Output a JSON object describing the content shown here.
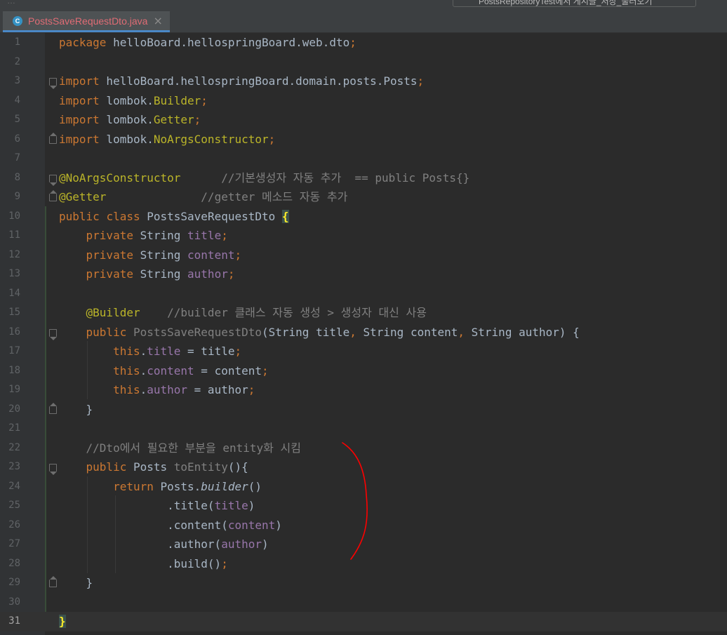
{
  "window": {
    "top_fragment_left": "…",
    "run_config": "PostsRepositoryTest에서 게시글_저장_불러오기"
  },
  "tab": {
    "icon_letter": "C",
    "filename": "PostsSaveRequestDto.java",
    "close_glyph": "×"
  },
  "lines": [
    {
      "n": "1",
      "text": "package helloBoard.hellospringBoard.web.dto;"
    },
    {
      "n": "2",
      "text": ""
    },
    {
      "n": "3",
      "text": "import helloBoard.hellospringBoard.domain.posts.Posts;"
    },
    {
      "n": "4",
      "text": "import lombok.Builder;"
    },
    {
      "n": "5",
      "text": "import lombok.Getter;"
    },
    {
      "n": "6",
      "text": "import lombok.NoArgsConstructor;"
    },
    {
      "n": "7",
      "text": ""
    },
    {
      "n": "8",
      "text": "@NoArgsConstructor      //기본생성자 자동 추가  == public Posts{}"
    },
    {
      "n": "9",
      "text": "@Getter              //getter 메소드 자동 추가"
    },
    {
      "n": "10",
      "text": "public class PostsSaveRequestDto {"
    },
    {
      "n": "11",
      "text": "    private String title;"
    },
    {
      "n": "12",
      "text": "    private String content;"
    },
    {
      "n": "13",
      "text": "    private String author;"
    },
    {
      "n": "14",
      "text": ""
    },
    {
      "n": "15",
      "text": "    @Builder    //builder 클래스 자동 생성 > 생성자 대신 사용"
    },
    {
      "n": "16",
      "text": "    public PostsSaveRequestDto(String title, String content, String author) {"
    },
    {
      "n": "17",
      "text": "        this.title = title;"
    },
    {
      "n": "18",
      "text": "        this.content = content;"
    },
    {
      "n": "19",
      "text": "        this.author = author;"
    },
    {
      "n": "20",
      "text": "    }"
    },
    {
      "n": "21",
      "text": ""
    },
    {
      "n": "22",
      "text": "    //Dto에서 필요한 부분을 entity화 시킴"
    },
    {
      "n": "23",
      "text": "    public Posts toEntity(){"
    },
    {
      "n": "24",
      "text": "        return Posts.builder()"
    },
    {
      "n": "25",
      "text": "                .title(title)"
    },
    {
      "n": "26",
      "text": "                .content(content)"
    },
    {
      "n": "27",
      "text": "                .author(author)"
    },
    {
      "n": "28",
      "text": "                .build();"
    },
    {
      "n": "29",
      "text": "    }"
    },
    {
      "n": "30",
      "text": ""
    },
    {
      "n": "31",
      "text": "}"
    }
  ],
  "current_line": "31",
  "colors": {
    "background": "#2b2b2b",
    "gutter": "#313335",
    "keyword": "#cc7832",
    "annotation": "#bbb529",
    "comment": "#808080",
    "field": "#9876aa",
    "default_text": "#a9b7c6",
    "tab_active_text": "#e06c75",
    "tab_underline": "#4a88c7",
    "red_annotation_stroke": "#ff0000"
  }
}
